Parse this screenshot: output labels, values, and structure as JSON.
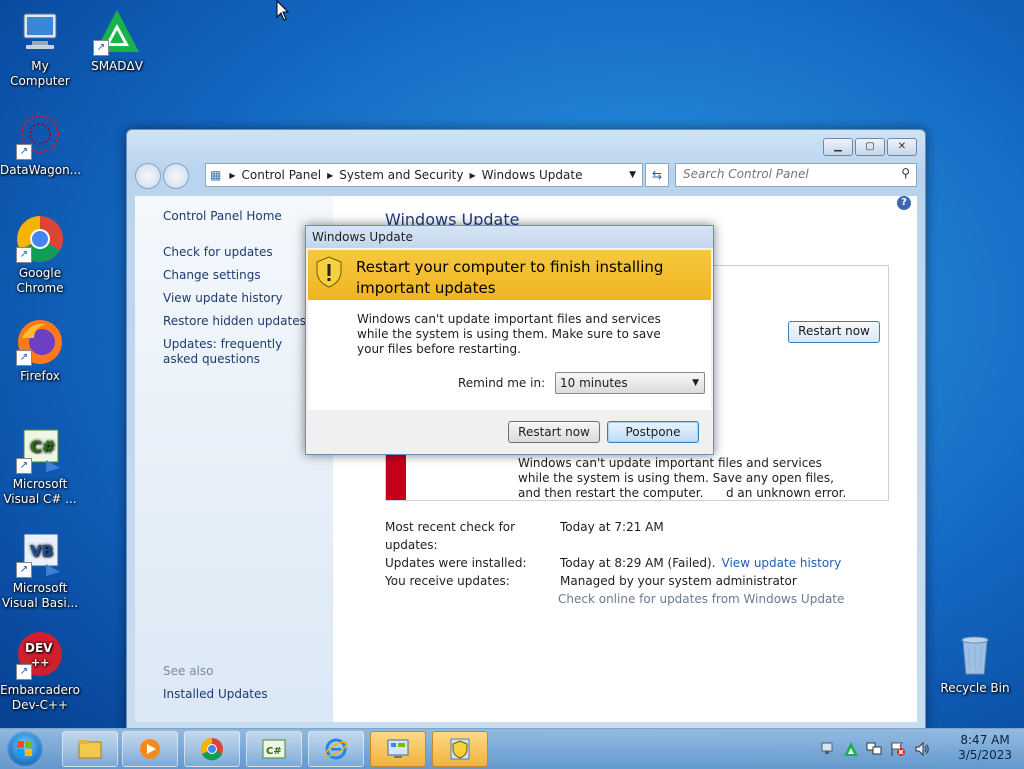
{
  "desktop": {
    "icons": [
      {
        "label": "My Computer",
        "icon": "computer-icon"
      },
      {
        "label": "SMADΔV",
        "icon": "smadav-icon"
      },
      {
        "label": "DataWagon...",
        "icon": "datawagon-icon"
      },
      {
        "label": "Google Chrome",
        "icon": "chrome-icon"
      },
      {
        "label": "Firefox",
        "icon": "firefox-icon"
      },
      {
        "label": "Microsoft Visual C# ...",
        "icon": "csharp-icon"
      },
      {
        "label": "Microsoft Visual Basi...",
        "icon": "vb-icon"
      },
      {
        "label": "Embarcadero Dev-C++",
        "icon": "devcpp-icon"
      },
      {
        "label": "Recycle Bin",
        "icon": "recycle-bin-icon"
      }
    ]
  },
  "window": {
    "breadcrumb": [
      "Control Panel",
      "System and Security",
      "Windows Update"
    ],
    "search_placeholder": "Search Control Panel",
    "left_nav": {
      "home": "Control Panel Home",
      "links": [
        "Check for updates",
        "Change settings",
        "View update history",
        "Restore hidden updates",
        "Updates: frequently asked questions"
      ],
      "see_also_label": "See also",
      "see_also_links": [
        "Installed Updates"
      ]
    },
    "main": {
      "title": "Windows Update",
      "restart_now_label": "Restart now",
      "error_heading": "d an unknown error.",
      "error_text": "Windows can't update important files and services while the system is using them. Save any open files, and then restart the computer.",
      "info": [
        {
          "key": "Most recent check for updates:",
          "value": "Today at 7:21 AM"
        },
        {
          "key": "Updates were installed:",
          "value": "Today at 8:29 AM (Failed).",
          "link": "View update history"
        },
        {
          "key": "You receive updates:",
          "value": "Managed by your system administrator"
        }
      ],
      "check_online": "Check online for updates from Windows Update"
    }
  },
  "dialog": {
    "title": "Windows Update",
    "banner": "Restart your computer to finish installing important updates",
    "message": "Windows can't update important files and services while the system is using them. Make sure to save your files before restarting.",
    "remind_label": "Remind me in:",
    "remind_value": "10 minutes",
    "restart_label": "Restart now",
    "postpone_label": "Postpone"
  },
  "taskbar": {
    "time": "8:47 AM",
    "date": "3/5/2023",
    "apps": [
      "explorer-icon",
      "media-player-icon",
      "chrome-icon",
      "csharp-icon",
      "ie-icon",
      "control-panel-icon",
      "windows-update-icon"
    ]
  },
  "colors": {
    "banner": "#f0b423",
    "error_bar": "#c4001a",
    "link": "#1e5fb8"
  }
}
